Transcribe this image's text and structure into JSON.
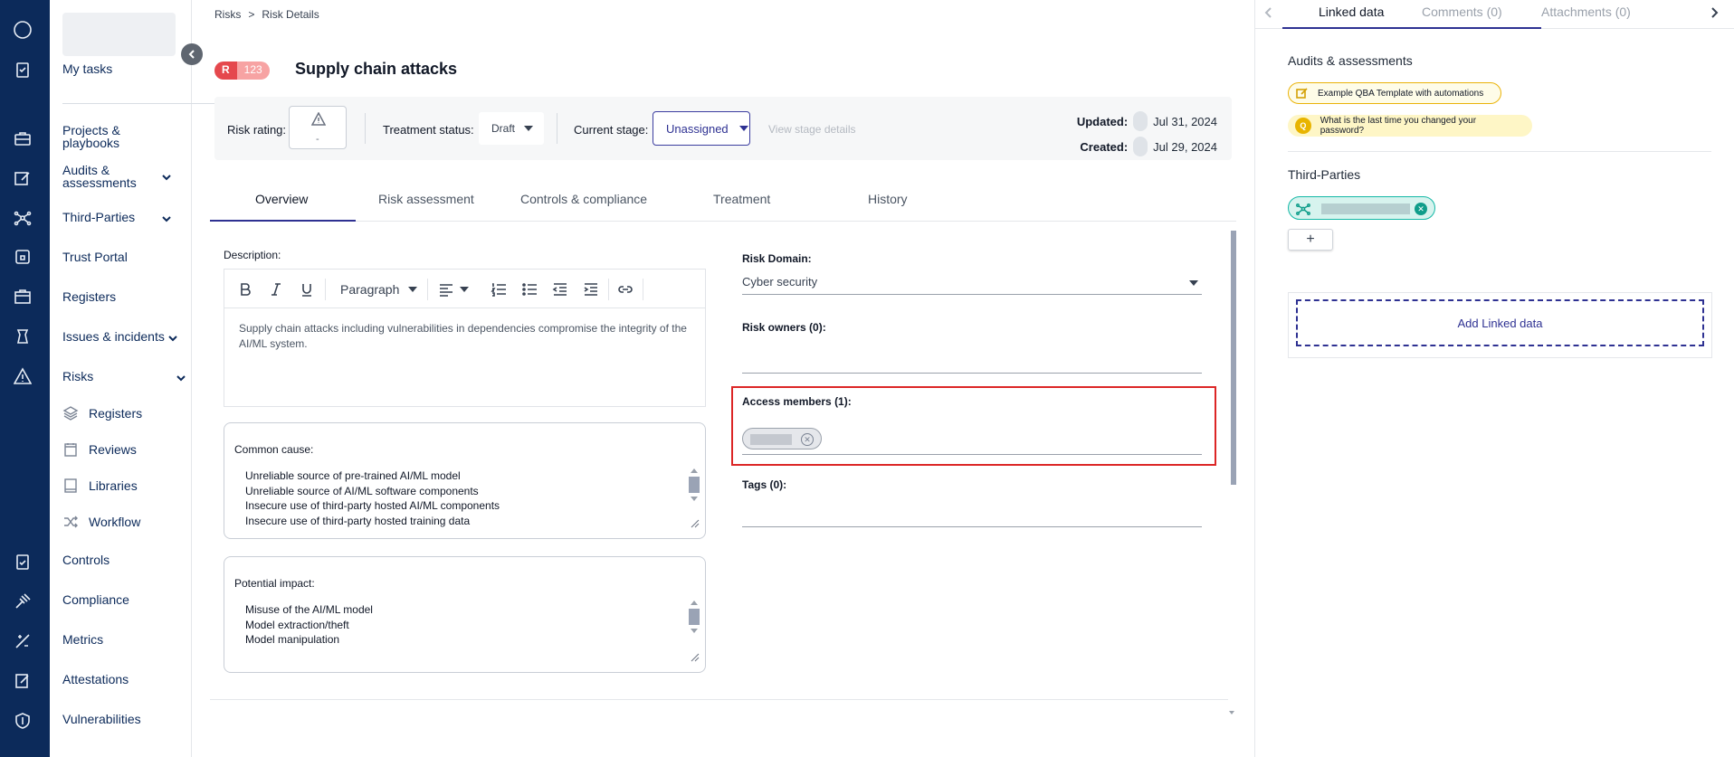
{
  "breadcrumb": {
    "root": "Risks",
    "separator": ">",
    "current": "Risk Details"
  },
  "sidebar": {
    "items": [
      {
        "label": "My tasks"
      },
      {
        "label": "Projects & playbooks"
      },
      {
        "label": "Audits & assessments"
      },
      {
        "label": "Third-Parties"
      },
      {
        "label": "Trust Portal"
      },
      {
        "label": "Registers"
      },
      {
        "label": "Issues & incidents"
      },
      {
        "label": "Risks"
      },
      {
        "label": "Controls"
      },
      {
        "label": "Compliance"
      },
      {
        "label": "Metrics"
      },
      {
        "label": "Attestations"
      },
      {
        "label": "Vulnerabilities"
      }
    ],
    "risk_subitems": [
      {
        "label": "Registers",
        "icon": "layers-icon"
      },
      {
        "label": "Reviews",
        "icon": "calendar-icon"
      },
      {
        "label": "Libraries",
        "icon": "book-icon"
      },
      {
        "label": "Workflow",
        "icon": "shuffle-icon"
      }
    ]
  },
  "risk": {
    "badge_letter": "R",
    "badge_number": "123",
    "title": "Supply chain attacks"
  },
  "summary": {
    "rating_label": "Risk rating:",
    "rating_value": "-",
    "treatment_label": "Treatment status:",
    "treatment_value": "Draft",
    "stage_label": "Current stage:",
    "stage_value": "Unassigned",
    "view_stage": "View stage details",
    "updated_label": "Updated:",
    "updated_value": "Jul 31, 2024",
    "created_label": "Created:",
    "created_value": "Jul 29, 2024"
  },
  "tabs": [
    {
      "label": "Overview",
      "active": true
    },
    {
      "label": "Risk assessment"
    },
    {
      "label": "Controls & compliance"
    },
    {
      "label": "Treatment"
    },
    {
      "label": "History"
    }
  ],
  "description": {
    "label": "Description:",
    "toolbar": {
      "paragraph": "Paragraph"
    },
    "text": "Supply chain attacks including vulnerabilities in dependencies compromise the integrity of the AI/ML system."
  },
  "common_cause": {
    "label": "Common cause:",
    "lines": [
      "Unreliable source of pre-trained AI/ML model",
      "Unreliable source of AI/ML software components",
      "Insecure use of third-party hosted AI/ML components",
      "Insecure use of third-party hosted training data"
    ]
  },
  "potential_impact": {
    "label": "Potential impact:",
    "lines": [
      "Misuse of the AI/ML model",
      "Model extraction/theft",
      "Model manipulation"
    ]
  },
  "form": {
    "risk_domain_label": "Risk Domain:",
    "risk_domain_value": "Cyber security",
    "risk_owners_label": "Risk owners (0):",
    "access_members_label": "Access members (1):",
    "tags_label": "Tags (0):"
  },
  "right_panel": {
    "tabs": [
      {
        "label": "Linked data",
        "active": true
      },
      {
        "label": "Comments (0)"
      },
      {
        "label": "Attachments (0)"
      }
    ],
    "audits_title": "Audits & assessments",
    "audit_items": [
      {
        "label": "Example QBA Template with automations"
      },
      {
        "badge": "Q",
        "label": "What is the last time you changed your password?"
      }
    ],
    "third_parties_title": "Third-Parties",
    "plus": "+",
    "add_linked": "Add Linked data"
  },
  "colors": {
    "rail": "#0c2a5a",
    "accent": "#2e3192",
    "highlight": "#dc2626",
    "badge": "#e5484d"
  }
}
